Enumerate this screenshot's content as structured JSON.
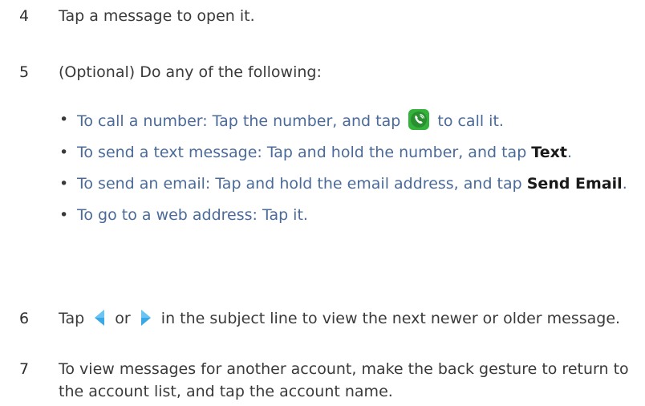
{
  "steps": [
    {
      "number": "4",
      "text": "Tap a message to open it."
    },
    {
      "number": "5",
      "text": "(Optional) Do any of the following:"
    },
    {
      "number": "6",
      "text_before": "Tap",
      "text_or": "or",
      "text_after": "in the subject line to view the next newer or older message."
    },
    {
      "number": "7",
      "text": "To view messages for another account, make the back gesture to return to the account list, and tap the account name."
    }
  ],
  "bullets": [
    {
      "before": "To call a number: Tap the number, and tap",
      "icon": "phone-call-icon",
      "after": "to call it."
    },
    {
      "before": "To send a text message: Tap and hold the number, and tap",
      "bold": "Text",
      "after": "."
    },
    {
      "before": "To send an email: Tap and hold the email address, and tap",
      "bold": "Send Email",
      "after": "."
    },
    {
      "before": "To go to a web address: Tap it."
    }
  ],
  "colors": {
    "body_text": "#3a3a3a",
    "bullet_text": "#4a6a9a",
    "bold_text": "#1a1a1a",
    "phone_icon": "#34b33a",
    "arrow_icon": "#3aa7e6"
  }
}
